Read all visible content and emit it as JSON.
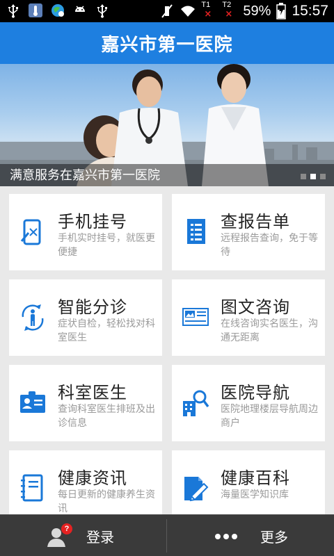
{
  "status_bar": {
    "left_icons": [
      "usb-icon",
      "thermometer-app-icon",
      "browser-app-icon",
      "android-icon",
      "usb-icon"
    ],
    "right_icons": [
      "mute-icon",
      "wifi-icon",
      "sim1-no-signal-icon",
      "sim2-no-signal-icon",
      "battery-charging-icon"
    ],
    "sim1_label": "T1",
    "sim2_label": "T2",
    "battery": "59%",
    "time": "15:57"
  },
  "header": {
    "title": "嘉兴市第一医院"
  },
  "banner": {
    "caption": "满意服务在嘉兴市第一医院",
    "slide_count": 3,
    "active_slide": 2
  },
  "services": [
    {
      "title": "手机挂号",
      "desc": "手机实时挂号，就医更便捷",
      "icon": "phone-register-icon"
    },
    {
      "title": "查报告单",
      "desc": "远程报告查询，免于等待",
      "icon": "report-document-icon"
    },
    {
      "title": "智能分诊",
      "desc": "症状自检，轻松找对科室医生",
      "icon": "smart-triage-icon"
    },
    {
      "title": "图文咨询",
      "desc": "在线咨询实名医生，沟通无距离",
      "icon": "image-text-consult-icon"
    },
    {
      "title": "科室医生",
      "desc": "查询科室医生排班及出诊信息",
      "icon": "doctor-id-card-icon"
    },
    {
      "title": "医院导航",
      "desc": "医院地理楼层导航周边商户",
      "icon": "hospital-navigation-icon"
    },
    {
      "title": "健康资讯",
      "desc": "每日更新的健康养生资讯",
      "icon": "health-news-notebook-icon"
    },
    {
      "title": "健康百科",
      "desc": "海量医学知识库",
      "icon": "health-encyclopedia-icon"
    }
  ],
  "bottom_bar": {
    "login_label": "登录",
    "login_badge": "?",
    "more_label": "更多"
  },
  "colors": {
    "primary": "#1e7fe0",
    "icon_blue": "#1a78d8",
    "background": "#e9e9e9",
    "bottom_bar": "#3a3a3a",
    "badge": "#e52222"
  }
}
